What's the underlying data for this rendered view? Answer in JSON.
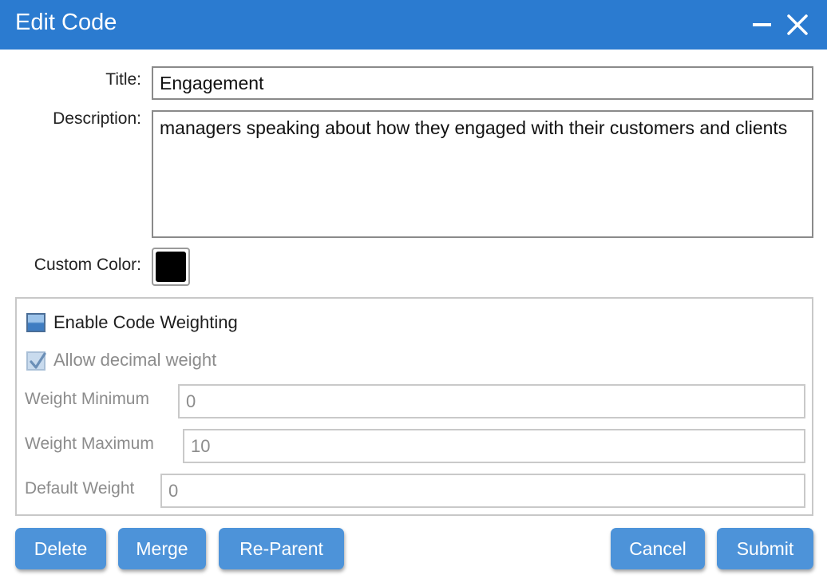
{
  "window": {
    "title": "Edit Code",
    "minimize_icon": "minimize-icon",
    "close_icon": "close-icon"
  },
  "form": {
    "title_label": "Title:",
    "title_value": "Engagement",
    "description_label": "Description:",
    "description_value": "managers speaking about how they engaged with their customers and clients",
    "custom_color_label": "Custom Color:",
    "custom_color_value": "#000000"
  },
  "weighting": {
    "enable_label": "Enable Code Weighting",
    "enable_checked": false,
    "decimal_label": "Allow decimal weight",
    "decimal_checked": true,
    "min_label": "Weight Minimum",
    "min_value": "0",
    "max_label": "Weight Maximum",
    "max_value": "10",
    "default_label": "Default Weight",
    "default_value": "0"
  },
  "buttons": {
    "delete": "Delete",
    "merge": "Merge",
    "reparent": "Re-Parent",
    "cancel": "Cancel",
    "submit": "Submit"
  },
  "colors": {
    "titlebar": "#2b7bd0",
    "button": "#4d93d9",
    "disabled_text": "#8c8c8c"
  }
}
